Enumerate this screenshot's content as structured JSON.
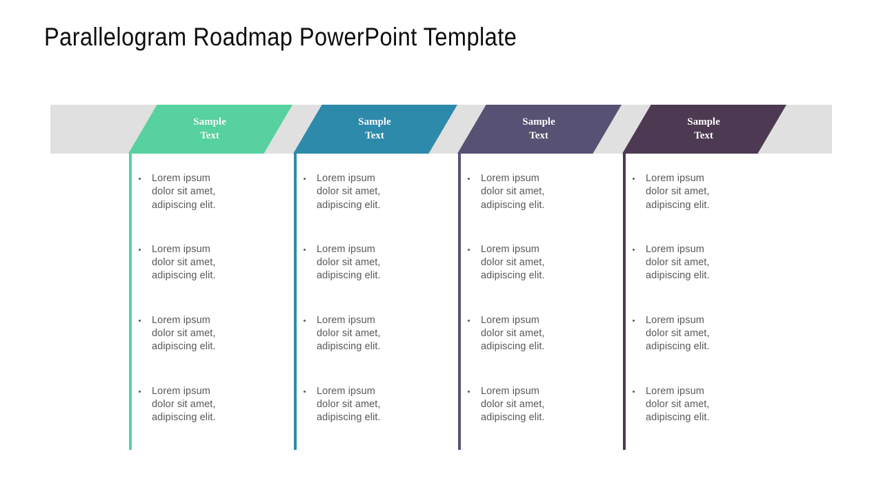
{
  "page": {
    "title": "Parallelogram Roadmap PowerPoint Template",
    "background": "#ffffff",
    "band_color": "#e0e0e0",
    "body_text_color": "#58585a"
  },
  "columns": [
    {
      "id": "column-1",
      "header": {
        "line1": "Sample",
        "line2": "Text"
      },
      "color": "#56d19f",
      "bullets": [
        {
          "line1": "Lorem ipsum",
          "line2": "dolor sit amet,",
          "line3": "adipiscing elit."
        },
        {
          "line1": "Lorem ipsum",
          "line2": "dolor sit amet,",
          "line3": "adipiscing elit."
        },
        {
          "line1": "Lorem ipsum",
          "line2": "dolor sit amet,",
          "line3": "adipiscing elit."
        },
        {
          "line1": "Lorem ipsum",
          "line2": "dolor sit amet,",
          "line3": "adipiscing elit."
        }
      ]
    },
    {
      "id": "column-2",
      "header": {
        "line1": "Sample",
        "line2": "Text"
      },
      "color": "#2e8aab",
      "bullets": [
        {
          "line1": "Lorem ipsum",
          "line2": "dolor sit amet,",
          "line3": "adipiscing elit."
        },
        {
          "line1": "Lorem ipsum",
          "line2": "dolor sit amet,",
          "line3": "adipiscing elit."
        },
        {
          "line1": "Lorem ipsum",
          "line2": "dolor sit amet,",
          "line3": "adipiscing elit."
        },
        {
          "line1": "Lorem ipsum",
          "line2": "dolor sit amet,",
          "line3": "adipiscing elit."
        }
      ]
    },
    {
      "id": "column-3",
      "header": {
        "line1": "Sample",
        "line2": "Text"
      },
      "color": "#575273",
      "bullets": [
        {
          "line1": "Lorem ipsum",
          "line2": "dolor sit amet,",
          "line3": "adipiscing elit."
        },
        {
          "line1": "Lorem ipsum",
          "line2": "dolor sit amet,",
          "line3": "adipiscing elit."
        },
        {
          "line1": "Lorem ipsum",
          "line2": "dolor sit amet,",
          "line3": "adipiscing elit."
        },
        {
          "line1": "Lorem ipsum",
          "line2": "dolor sit amet,",
          "line3": "adipiscing elit."
        }
      ]
    },
    {
      "id": "column-4",
      "header": {
        "line1": "Sample",
        "line2": "Text"
      },
      "color": "#4d3a52",
      "bullets": [
        {
          "line1": "Lorem ipsum",
          "line2": "dolor sit amet,",
          "line3": "adipiscing elit."
        },
        {
          "line1": "Lorem ipsum",
          "line2": "dolor sit amet,",
          "line3": "adipiscing elit."
        },
        {
          "line1": "Lorem ipsum",
          "line2": "dolor sit amet,",
          "line3": "adipiscing elit."
        },
        {
          "line1": "Lorem ipsum",
          "line2": "dolor sit amet,",
          "line3": "adipiscing elit."
        }
      ]
    }
  ]
}
